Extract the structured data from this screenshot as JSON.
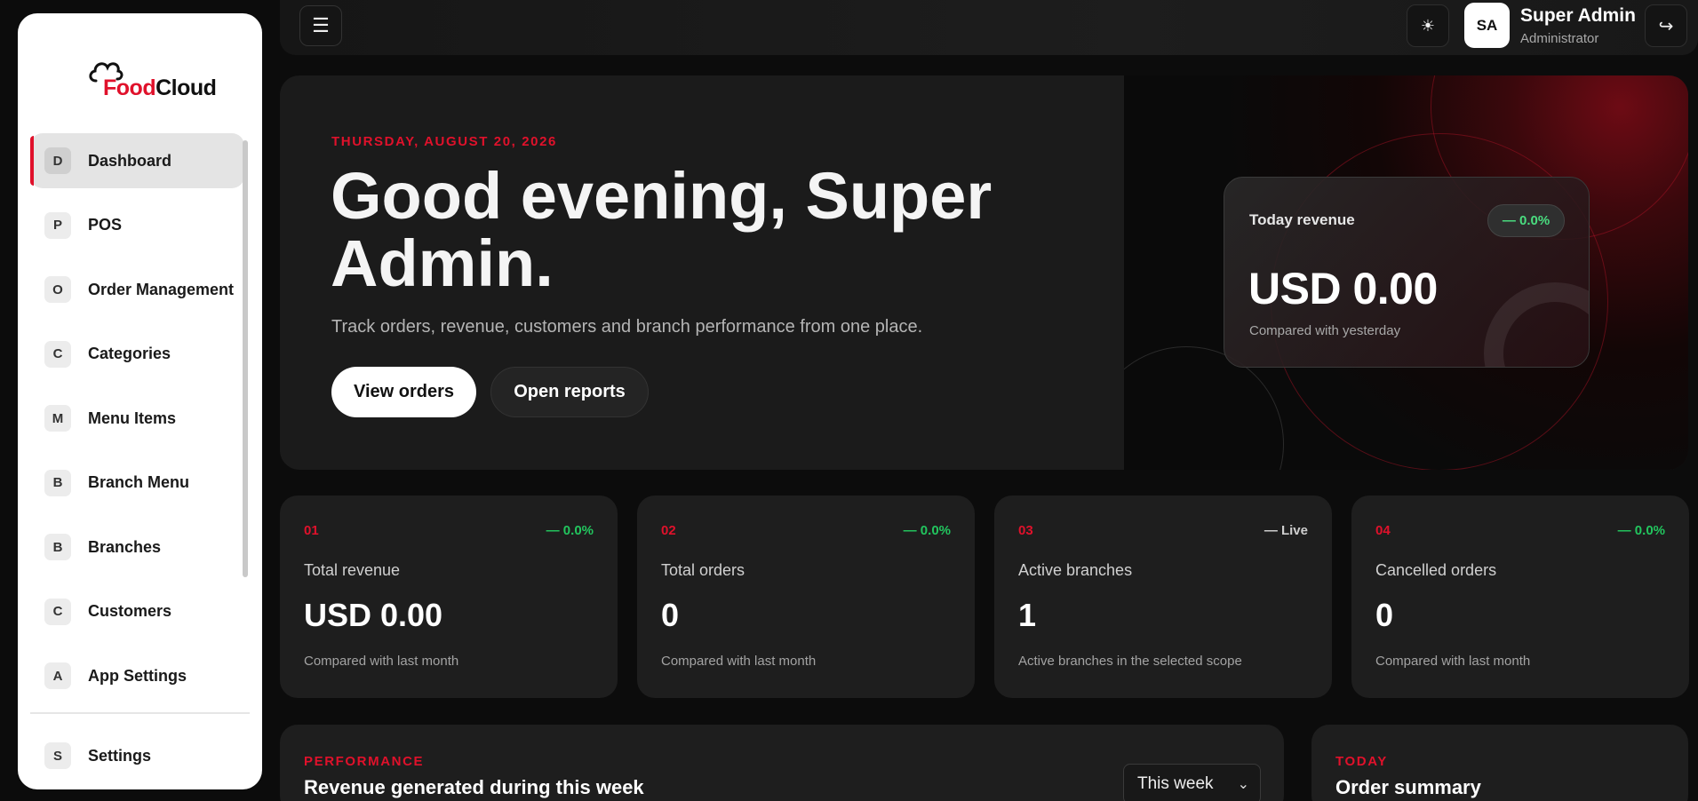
{
  "brand": {
    "name_part1": "Food",
    "name_part2": "Cloud"
  },
  "sidebar": {
    "items": [
      {
        "badge": "D",
        "label": "Dashboard"
      },
      {
        "badge": "P",
        "label": "POS"
      },
      {
        "badge": "O",
        "label": "Order Management"
      },
      {
        "badge": "C",
        "label": "Categories"
      },
      {
        "badge": "M",
        "label": "Menu Items"
      },
      {
        "badge": "B",
        "label": "Branch Menu"
      },
      {
        "badge": "B",
        "label": "Branches"
      },
      {
        "badge": "C",
        "label": "Customers"
      },
      {
        "badge": "A",
        "label": "App Settings"
      }
    ],
    "settings": {
      "badge": "S",
      "label": "Settings"
    }
  },
  "topbar": {
    "menu_icon": "☰",
    "theme_icon": "☀",
    "avatar_initials": "SA",
    "user_name": "Super Admin",
    "user_role": "Administrator",
    "logout_icon": "↪"
  },
  "hero": {
    "date": "THURSDAY, AUGUST 20, 2026",
    "greeting": "Good evening, Super Admin.",
    "subtitle": "Track orders, revenue, customers and branch performance from one place.",
    "primary_button": "View orders",
    "secondary_button": "Open reports",
    "revenue_card": {
      "label": "Today revenue",
      "badge": "— 0.0%",
      "value": "USD 0.00",
      "note": "Compared with yesterday"
    }
  },
  "stats": [
    {
      "num": "01",
      "change": "— 0.0%",
      "label": "Total revenue",
      "value": "USD 0.00",
      "note": "Compared with last month"
    },
    {
      "num": "02",
      "change": "— 0.0%",
      "label": "Total orders",
      "value": "0",
      "note": "Compared with last month"
    },
    {
      "num": "03",
      "change": "— Live",
      "label": "Active branches",
      "value": "1",
      "note": "Active branches in the selected scope"
    },
    {
      "num": "04",
      "change": "— 0.0%",
      "label": "Cancelled orders",
      "value": "0",
      "note": "Compared with last month"
    }
  ],
  "performance": {
    "kicker": "PERFORMANCE",
    "title": "Revenue generated during this week",
    "period_selected": "This week"
  },
  "today": {
    "kicker": "TODAY",
    "title": "Order summary"
  },
  "colors": {
    "accent": "#e0112b",
    "positive": "#22c55e",
    "background": "#0c0c0c",
    "card": "#1e1e1e"
  }
}
